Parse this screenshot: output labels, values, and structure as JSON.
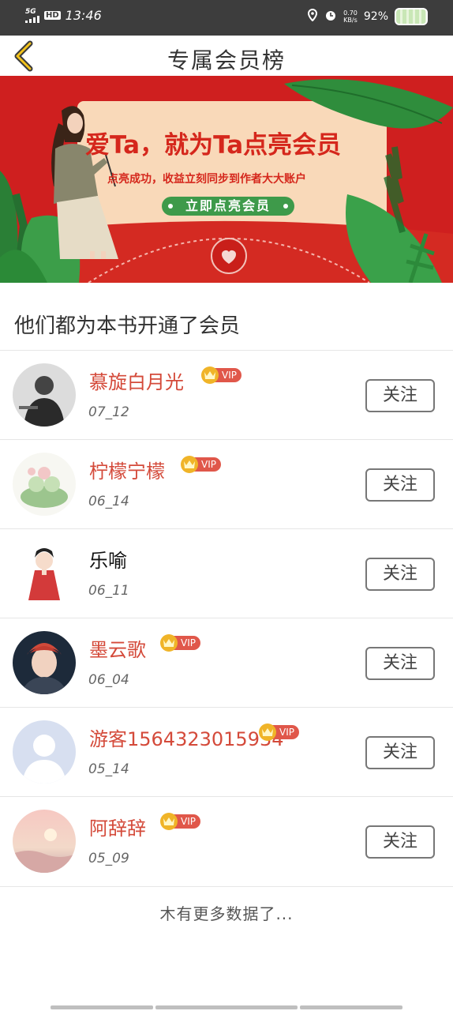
{
  "status_bar": {
    "network": "5G",
    "hd": "HD",
    "time": "13:46",
    "speed_value": "0.70",
    "speed_unit": "KB/s",
    "battery": "92%"
  },
  "header": {
    "title": "专属会员榜"
  },
  "banner": {
    "headline": "爱Ta，就为Ta点亮会员",
    "subline": "点亮成功，收益立刻同步到作者大大账户",
    "button": "立即点亮会员"
  },
  "section_title": "他们都为本书开通了会员",
  "members": [
    {
      "name": "慕旋白月光",
      "vip": true,
      "vip_label": "VIP",
      "date": "07_12",
      "follow": "关注"
    },
    {
      "name": "柠檬宁檬",
      "vip": true,
      "vip_label": "VIP",
      "date": "06_14",
      "follow": "关注"
    },
    {
      "name": "乐喻",
      "vip": false,
      "date": "06_11",
      "follow": "关注"
    },
    {
      "name": "墨云歌",
      "vip": true,
      "vip_label": "VIP",
      "date": "06_04",
      "follow": "关注"
    },
    {
      "name": "游客1564323015934",
      "vip": true,
      "vip_label": "VIP",
      "date": "05_14",
      "follow": "关注"
    },
    {
      "name": "阿辞辞",
      "vip": true,
      "vip_label": "VIP",
      "date": "05_09",
      "follow": "关注"
    }
  ],
  "footer": "木有更多数据了..."
}
